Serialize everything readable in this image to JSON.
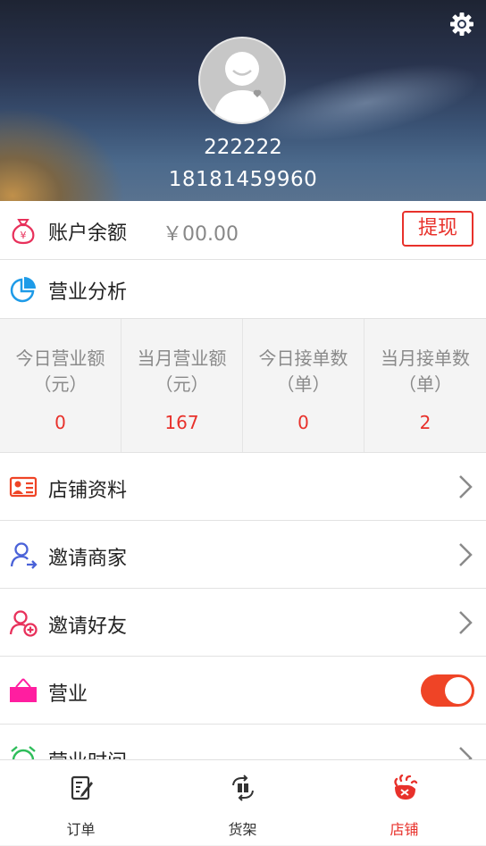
{
  "profile": {
    "name": "222222",
    "phone": "18181459960"
  },
  "balance": {
    "label": "账户余额",
    "amount": "￥00.00",
    "withdraw_label": "提现"
  },
  "analysis": {
    "label": "营业分析"
  },
  "stats": [
    {
      "line1": "今日营业额",
      "line2": "（元）",
      "value": "0"
    },
    {
      "line1": "当月营业额",
      "line2": "（元）",
      "value": "167"
    },
    {
      "line1": "今日接单数",
      "line2": "（单）",
      "value": "0"
    },
    {
      "line1": "当月接单数",
      "line2": "（单）",
      "value": "2"
    }
  ],
  "menu": {
    "store_info": "店铺资料",
    "invite_merchant": "邀请商家",
    "invite_friend": "邀请好友",
    "business": "营业",
    "business_hours": "营业时间"
  },
  "business_toggle": {
    "on": true
  },
  "tabs": [
    {
      "label": "订单",
      "icon": "order-icon"
    },
    {
      "label": "货架",
      "icon": "shelf-icon"
    },
    {
      "label": "店铺",
      "icon": "store-icon",
      "active": true
    }
  ],
  "colors": {
    "accent": "#e8312b",
    "toggle_on": "#ef4426"
  }
}
